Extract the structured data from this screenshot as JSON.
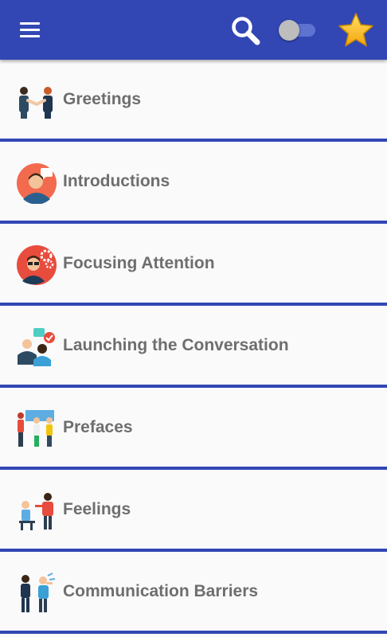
{
  "toolbar": {
    "menu_icon": "hamburger-menu-icon",
    "search_icon": "search-icon",
    "toggle_state": "off",
    "favorite_icon": "star-icon",
    "color_primary": "#3247b4",
    "color_star": "#f9c22e"
  },
  "topics": [
    {
      "label": "Greetings",
      "icon": "handshake-icon"
    },
    {
      "label": "Introductions",
      "icon": "person-speech-bubble-icon"
    },
    {
      "label": "Focusing Attention",
      "icon": "businessman-gears-icon"
    },
    {
      "label": "Launching the Conversation",
      "icon": "two-people-chat-icon"
    },
    {
      "label": "Prefaces",
      "icon": "presentation-group-icon"
    },
    {
      "label": "Feelings",
      "icon": "desk-conversation-icon"
    },
    {
      "label": "Communication Barriers",
      "icon": "two-people-speaking-icon"
    }
  ]
}
